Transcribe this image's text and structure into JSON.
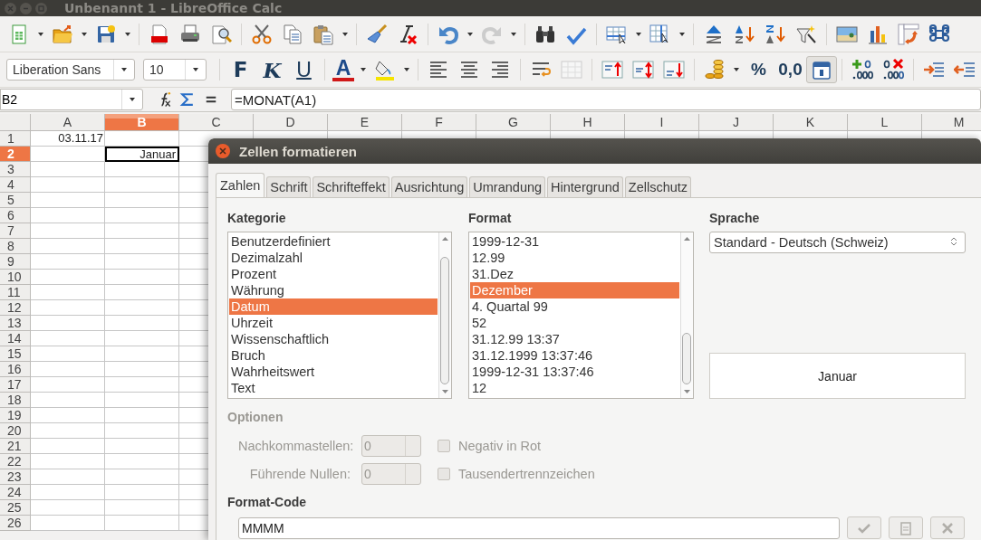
{
  "window": {
    "title": "Unbenannt 1 - LibreOffice Calc"
  },
  "formatting_toolbar": {
    "font_name": "Liberation Sans",
    "font_size": "10",
    "bold_label": "F",
    "italic_label": "K",
    "underline_label": "U",
    "font_color_label": "A",
    "percent_label": "%",
    "number_label": "0,0",
    "date_pressed": true
  },
  "formula_bar": {
    "cell_reference": "B2",
    "formula": "=MONAT(A1)"
  },
  "sheet": {
    "columns": [
      {
        "label": "A",
        "selected": false
      },
      {
        "label": "B",
        "selected": true
      },
      {
        "label": "C",
        "selected": false
      },
      {
        "label": "D",
        "selected": false
      },
      {
        "label": "E",
        "selected": false
      },
      {
        "label": "F",
        "selected": false
      },
      {
        "label": "G",
        "selected": false
      },
      {
        "label": "H",
        "selected": false
      },
      {
        "label": "I",
        "selected": false
      },
      {
        "label": "J",
        "selected": false
      },
      {
        "label": "K",
        "selected": false
      },
      {
        "label": "L",
        "selected": false
      },
      {
        "label": "M",
        "selected": false
      }
    ],
    "rows": [
      {
        "label": "1",
        "selected": false
      },
      {
        "label": "2",
        "selected": true
      },
      {
        "label": "3",
        "selected": false
      },
      {
        "label": "4",
        "selected": false
      },
      {
        "label": "5",
        "selected": false
      },
      {
        "label": "6",
        "selected": false
      },
      {
        "label": "7",
        "selected": false
      },
      {
        "label": "8",
        "selected": false
      },
      {
        "label": "9",
        "selected": false
      },
      {
        "label": "10",
        "selected": false
      },
      {
        "label": "11",
        "selected": false
      },
      {
        "label": "12",
        "selected": false
      },
      {
        "label": "13",
        "selected": false
      },
      {
        "label": "14",
        "selected": false
      },
      {
        "label": "15",
        "selected": false
      },
      {
        "label": "16",
        "selected": false
      },
      {
        "label": "17",
        "selected": false
      },
      {
        "label": "18",
        "selected": false
      },
      {
        "label": "19",
        "selected": false
      },
      {
        "label": "20",
        "selected": false
      },
      {
        "label": "21",
        "selected": false
      },
      {
        "label": "22",
        "selected": false
      },
      {
        "label": "23",
        "selected": false
      },
      {
        "label": "24",
        "selected": false
      },
      {
        "label": "25",
        "selected": false
      },
      {
        "label": "26",
        "selected": false
      }
    ],
    "cell_a1": "03.11.17",
    "cell_b2": "Januar"
  },
  "dialog": {
    "title": "Zellen formatieren",
    "tabs": [
      {
        "label": "Zahlen",
        "selected": true
      },
      {
        "label": "Schrift",
        "selected": false
      },
      {
        "label": "Schrifteffekt",
        "selected": false
      },
      {
        "label": "Ausrichtung",
        "selected": false
      },
      {
        "label": "Umrandung",
        "selected": false
      },
      {
        "label": "Hintergrund",
        "selected": false
      },
      {
        "label": "Zellschutz",
        "selected": false
      }
    ],
    "category": {
      "label": "Kategorie",
      "items": [
        {
          "text": "Benutzerdefiniert",
          "selected": false
        },
        {
          "text": "Dezimalzahl",
          "selected": false
        },
        {
          "text": "Prozent",
          "selected": false
        },
        {
          "text": "Währung",
          "selected": false
        },
        {
          "text": "Datum",
          "selected": true
        },
        {
          "text": "Uhrzeit",
          "selected": false
        },
        {
          "text": "Wissenschaftlich",
          "selected": false
        },
        {
          "text": "Bruch",
          "selected": false
        },
        {
          "text": "Wahrheitswert",
          "selected": false
        },
        {
          "text": "Text",
          "selected": false
        }
      ]
    },
    "format": {
      "label": "Format",
      "items": [
        {
          "text": "1999-12-31",
          "selected": false
        },
        {
          "text": "12.99",
          "selected": false
        },
        {
          "text": "31.Dez",
          "selected": false
        },
        {
          "text": "Dezember",
          "selected": true
        },
        {
          "text": "4. Quartal 99",
          "selected": false
        },
        {
          "text": "52",
          "selected": false
        },
        {
          "text": "31.12.99 13:37",
          "selected": false
        },
        {
          "text": "31.12.1999 13:37:46",
          "selected": false
        },
        {
          "text": "1999-12-31 13:37:46",
          "selected": false
        },
        {
          "text": "12",
          "selected": false
        }
      ]
    },
    "language": {
      "label": "Sprache",
      "value": "Standard - Deutsch (Schweiz)"
    },
    "preview": "Januar",
    "options": {
      "label": "Optionen",
      "decimal_places": {
        "label": "Nachkommastellen:",
        "value": "0",
        "disabled": true
      },
      "leading_zeros": {
        "label": "Führende Nullen:",
        "value": "0",
        "disabled": true
      },
      "negative_in_red": {
        "label": "Negativ in Rot",
        "checked": false,
        "disabled": true
      },
      "thousands_separator": {
        "label": "Tausendertrennzeichen",
        "checked": false,
        "disabled": true
      }
    },
    "format_code": {
      "label": "Format-Code",
      "value": "MMMM"
    }
  }
}
